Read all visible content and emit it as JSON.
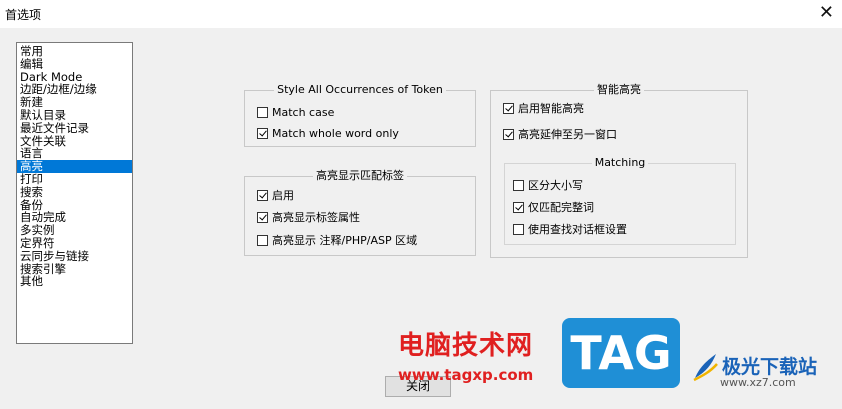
{
  "window": {
    "title": "首选项",
    "close_glyph": "✕"
  },
  "categories": {
    "items": [
      "常用",
      "编辑",
      "Dark Mode",
      "边距/边框/边缘",
      "新建",
      "默认目录",
      "最近文件记录",
      "文件关联",
      "语言",
      "高亮",
      "打印",
      "搜索",
      "备份",
      "自动完成",
      "多实例",
      "定界符",
      "云同步与链接",
      "搜索引擎",
      "其他"
    ],
    "selected": "高亮"
  },
  "style_group": {
    "title": "Style All Occurrences of Token",
    "match_case": {
      "label": "Match case",
      "checked": false
    },
    "match_whole_word": {
      "label": "Match whole word only",
      "checked": true
    }
  },
  "tag_group": {
    "title": "高亮显示匹配标签",
    "enable": {
      "label": "启用",
      "checked": true
    },
    "tag_attr": {
      "label": "高亮显示标签属性",
      "checked": true
    },
    "comment_zone": {
      "label": "高亮显示 注释/PHP/ASP 区域",
      "checked": false
    }
  },
  "smart_group": {
    "title": "智能高亮",
    "enable": {
      "label": "启用智能高亮",
      "checked": true
    },
    "extend_view": {
      "label": "高亮延伸至另一窗口",
      "checked": true
    },
    "matching": {
      "title": "Matching",
      "case_sensitive": {
        "label": "区分大小写",
        "checked": false
      },
      "whole_word": {
        "label": "仅匹配完整词",
        "checked": true
      },
      "use_find_settings": {
        "label": "使用查找对话框设置",
        "checked": false
      }
    }
  },
  "buttons": {
    "close": "关闭"
  },
  "watermark": {
    "site_name": "电脑技术网",
    "site_url": "www.tagxp.com",
    "tag": "TAG",
    "brand": "极光下载站",
    "brand_url": "www.xz7.com"
  }
}
